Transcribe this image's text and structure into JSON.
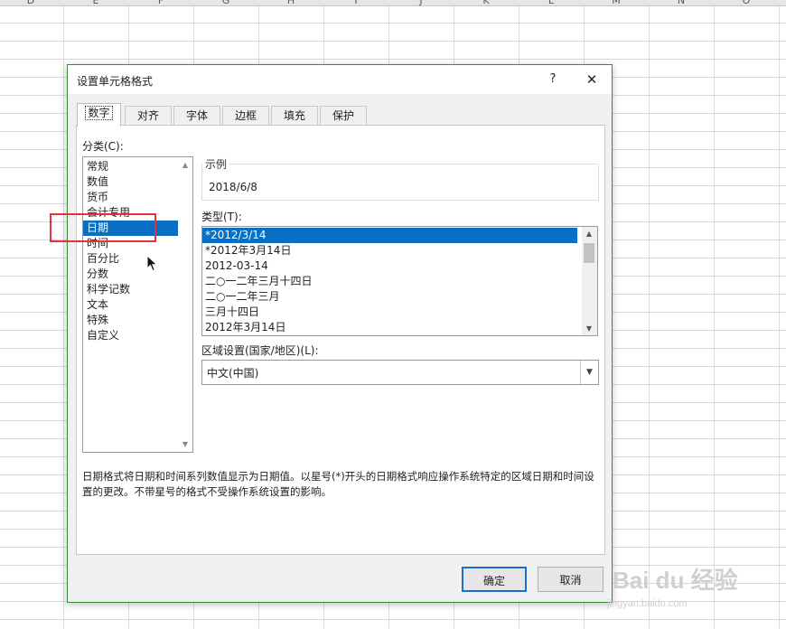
{
  "sheet": {
    "columns": [
      "D",
      "E",
      "F",
      "G",
      "H",
      "I",
      "J",
      "K",
      "L",
      "M",
      "N",
      "O"
    ]
  },
  "dialog": {
    "title": "设置单元格格式",
    "help": "?",
    "close": "✕",
    "tabs": [
      "数字",
      "对齐",
      "字体",
      "边框",
      "填充",
      "保护"
    ],
    "active_tab": "数字",
    "category_label": "分类(C):",
    "categories": [
      "常规",
      "数值",
      "货币",
      "会计专用",
      "日期",
      "时间",
      "百分比",
      "分数",
      "科学记数",
      "文本",
      "特殊",
      "自定义"
    ],
    "selected_category": "日期",
    "sample_title": "示例",
    "sample_value": "2018/6/8",
    "type_label": "类型(T):",
    "types": [
      "*2012/3/14",
      "*2012年3月14日",
      "2012-03-14",
      "二○一二年三月十四日",
      "二○一二年三月",
      "三月十四日",
      "2012年3月14日"
    ],
    "selected_type": "*2012/3/14",
    "locale_label": "区域设置(国家/地区)(L):",
    "locale_value": "中文(中国)",
    "description": "日期格式将日期和时间系列数值显示为日期值。以星号(*)开头的日期格式响应操作系统特定的区域日期和时间设置的更改。不带星号的格式不受操作系统设置的影响。",
    "ok_label": "确定",
    "cancel_label": "取消"
  },
  "watermark": {
    "logo": "Bai du 经验",
    "url": "jingyan.baidu.com"
  },
  "colors": {
    "selection": "#0a6fc2",
    "highlight_box": "#e8303a",
    "dialog_border": "#3a8a3a"
  }
}
